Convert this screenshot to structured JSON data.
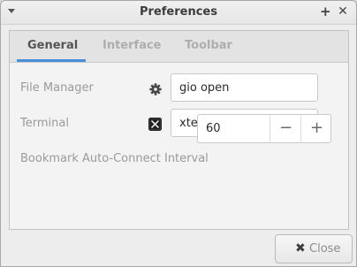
{
  "window": {
    "title": "Preferences",
    "menu_icon": "chevron-down-icon",
    "maximize_glyph": "+",
    "close_glyph": "✕"
  },
  "tabs": [
    {
      "label": "General",
      "active": true
    },
    {
      "label": "Interface",
      "active": false
    },
    {
      "label": "Toolbar",
      "active": false
    }
  ],
  "general": {
    "file_manager": {
      "label": "File Manager",
      "icon": "gear-icon",
      "value": "gio open"
    },
    "terminal": {
      "label": "Terminal",
      "icon": "terminal-icon",
      "value": "xterm"
    },
    "bookmark_interval": {
      "label": "Bookmark Auto-Connect Interval",
      "value": "60",
      "decrement": "−",
      "increment": "+"
    }
  },
  "footer": {
    "close_label": "Close",
    "close_icon_glyph": "✖"
  },
  "colors": {
    "accent": "#4a90d9",
    "window_bg": "#ededed",
    "tab_inactive_text": "#aeaeae"
  }
}
